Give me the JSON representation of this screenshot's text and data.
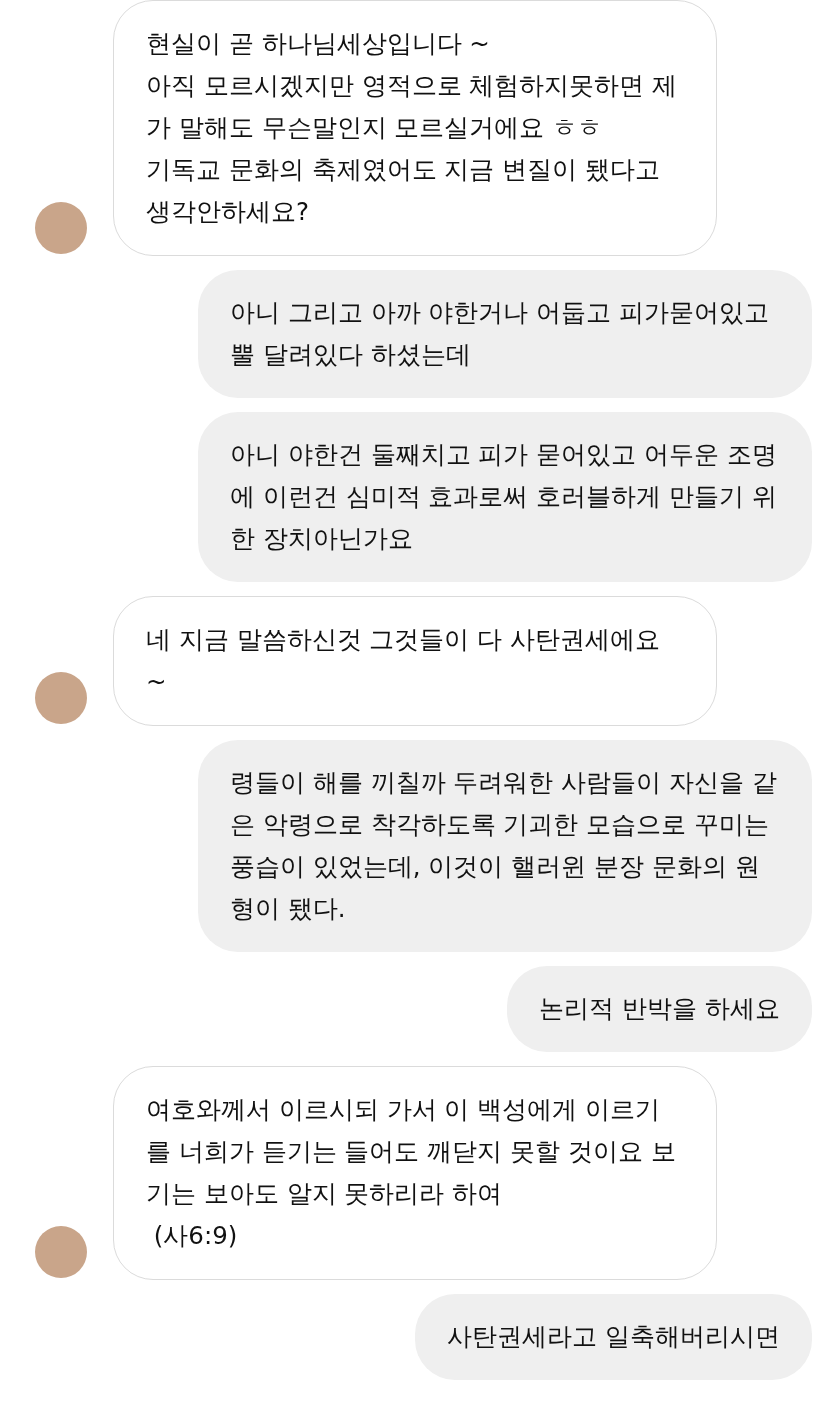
{
  "messages": [
    {
      "kind": "incoming",
      "text": "현실이 곧 하나님세상입니다 ~\n아직 모르시겠지만 영적으로 체험하지못하면 제가 말해도 무슨말인지 모르실거에요 ㅎㅎ\n기독교 문화의 축제였어도 지금 변질이 됐다고 생각안하세요?"
    },
    {
      "kind": "outgoing",
      "text": "아니 그리고 아까 야한거나 어둡고 피가묻어있고 뿔 달려있다 하셨는데"
    },
    {
      "kind": "outgoing",
      "text": "아니 야한건 둘째치고 피가 묻어있고 어두운 조명에 이런건 심미적 효과로써 호러블하게 만들기 위한 장치아닌가요"
    },
    {
      "kind": "incoming",
      "text": "네 지금 말씀하신것 그것들이 다 사탄권세에요 ~"
    },
    {
      "kind": "outgoing",
      "text": "령들이 해를 끼칠까 두려워한 사람들이 자신을 같은 악령으로 착각하도록 기괴한 모습으로 꾸미는 풍습이 있었는데, 이것이 핼러윈 분장 문화의 원형이 됐다."
    },
    {
      "kind": "outgoing",
      "text": "논리적 반박을 하세요"
    },
    {
      "kind": "incoming",
      "text": "여호와께서 이르시되 가서 이 백성에게 이르기를 너희가 듣기는 들어도 깨닫지 못할 것이요 보기는 보아도 알지 못하리라 하여\n (사6:9)"
    },
    {
      "kind": "outgoing",
      "text": "사탄권세라고 일축해버리시면"
    }
  ]
}
